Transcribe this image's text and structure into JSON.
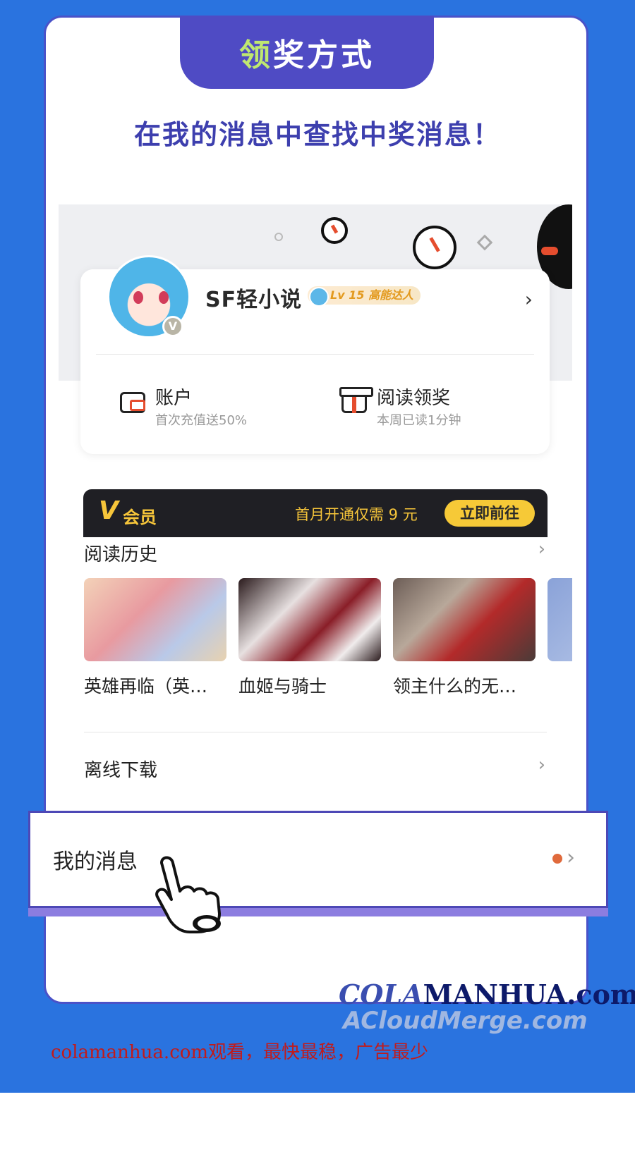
{
  "header": {
    "title_first": "领",
    "title_rest": "奖方式",
    "subtitle": "在我的消息中查找中奖消息！"
  },
  "profile": {
    "name": "SF轻小说",
    "level": "Lv 15 高能达人",
    "avatar_badge": "V"
  },
  "quick_actions": [
    {
      "label": "账户",
      "sub": "首次充值送50%",
      "icon": "wallet-icon"
    },
    {
      "label": "阅读领奖",
      "sub": "本周已读1分钟",
      "icon": "gift-icon"
    }
  ],
  "vip": {
    "logo_letter": "V",
    "logo_text": "会员",
    "promo": "首月开通仅需 9 元",
    "button": "立即前往"
  },
  "reading_history": {
    "title": "阅读历史",
    "books": [
      {
        "title": "英雄再临（英…",
        "cover_color": "#e9b4a8"
      },
      {
        "title": "血姬与骑士",
        "cover_color": "#7a2a30"
      },
      {
        "title": "领主什么的无…",
        "cover_color": "#5a4a48"
      }
    ]
  },
  "offline": {
    "title": "离线下载"
  },
  "messages": {
    "title": "我的消息"
  },
  "watermark": {
    "line1_a": "COLA",
    "line1_b": "MANHUA.com",
    "line2": "ACloudMerge.com"
  },
  "footer": {
    "text": "colamanhua.com观看，最快最稳，广告最少"
  },
  "colors": {
    "background": "#2a73df",
    "accent": "#4f4bc4",
    "vip_gold": "#f6c53a",
    "notification_dot": "#e06a3c"
  }
}
